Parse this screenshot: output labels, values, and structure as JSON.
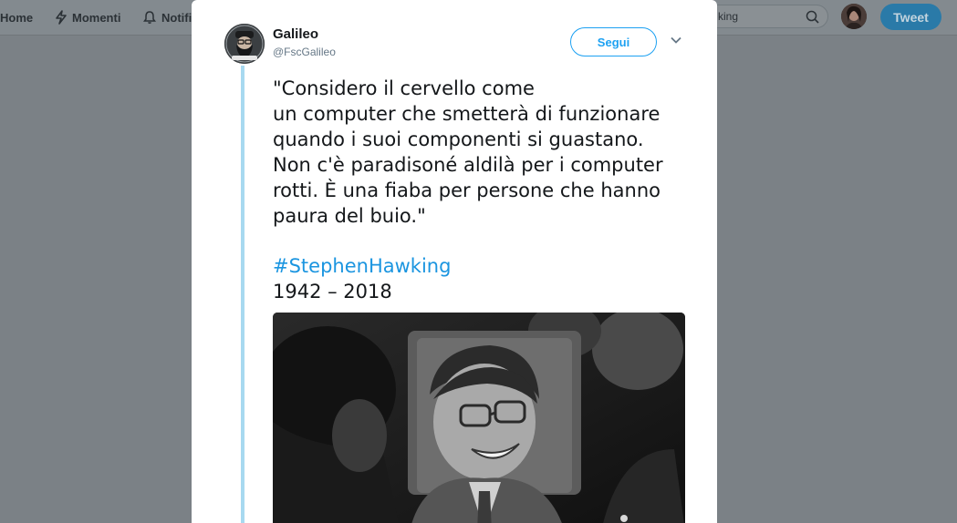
{
  "nav": {
    "home_label": "Home",
    "moments_label": "Momenti",
    "notifications_label": "Notifi",
    "search_value": "king",
    "tweet_button_label": "Tweet"
  },
  "tweet": {
    "author_name": "Galileo",
    "author_handle": "@FscGalileo",
    "follow_label": "Segui",
    "text_lines": [
      "\"Considero il cervello come",
      "un computer che smetterà di funzionare",
      "quando i suoi componenti si guastano.",
      "Non c'è paradisoné aldilà per i computer",
      "rotti. È una fiaba per persone che hanno",
      "paura del buio.\""
    ],
    "hashtag": "#StephenHawking",
    "years": "1942 – 2018"
  },
  "colors": {
    "link_blue": "#1b95e0",
    "follow_blue": "#1da1f2",
    "thread_line": "#a7d9f0",
    "overlay_gray": "#7b8186"
  },
  "icons": [
    "home-icon",
    "moments-icon",
    "bell-icon",
    "search-icon",
    "chevron-down-icon"
  ]
}
